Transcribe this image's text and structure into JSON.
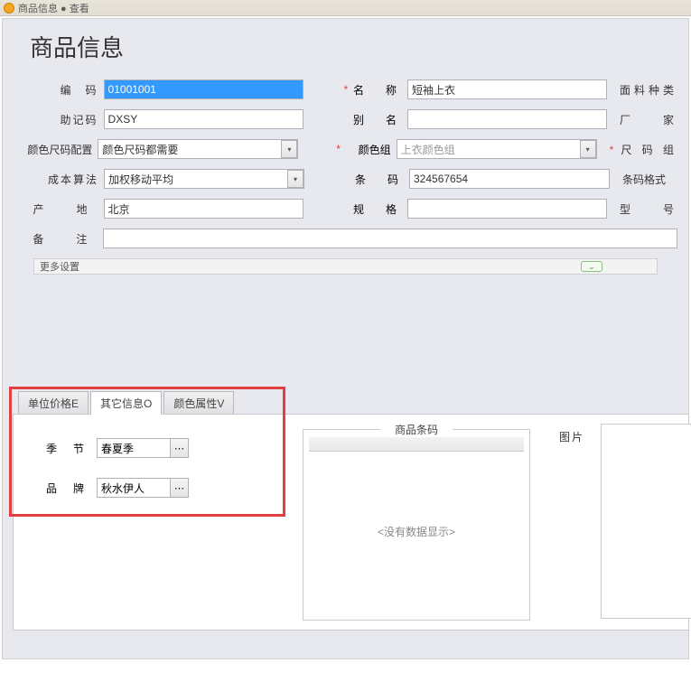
{
  "titlebar": {
    "text": "商品信息 ● 查看"
  },
  "page_title": "商品信息",
  "fields": {
    "code": {
      "label": "编　码",
      "value": "01001001"
    },
    "mnemonic": {
      "label": "助记码",
      "value": "DXSY"
    },
    "color_size_cfg": {
      "label": "颜色尺码配置",
      "value": "颜色尺码都需要"
    },
    "cost_method": {
      "label": "成本算法",
      "value": "加权移动平均"
    },
    "origin": {
      "label": "产　地",
      "value": "北京"
    },
    "remark": {
      "label": "备　注",
      "value": ""
    },
    "name": {
      "label": "名　称",
      "value": "短袖上衣"
    },
    "alias": {
      "label": "别　名",
      "value": ""
    },
    "color_group": {
      "label": "颜色组",
      "value": "上衣颜色组"
    },
    "barcode": {
      "label": "条　码",
      "value": "324567654"
    },
    "spec": {
      "label": "规　格",
      "value": ""
    },
    "fabric_type": "面料种类",
    "manufacturer": "厂　　家",
    "size_group": "尺 码 组",
    "barcode_format": "条码格式",
    "model_no": "型　　号"
  },
  "more_settings": "更多设置",
  "tabs": {
    "unit_price": "单位价格E",
    "other_info": "其它信息O",
    "color_attr": "颜色属性V"
  },
  "other_info": {
    "season": {
      "label": "季节",
      "value": "春夏季"
    },
    "brand": {
      "label": "品牌",
      "value": "秋水伊人"
    }
  },
  "barcode_panel": {
    "title": "商品条码",
    "no_data": "<没有数据显示>"
  },
  "pic": {
    "label": "图片"
  }
}
